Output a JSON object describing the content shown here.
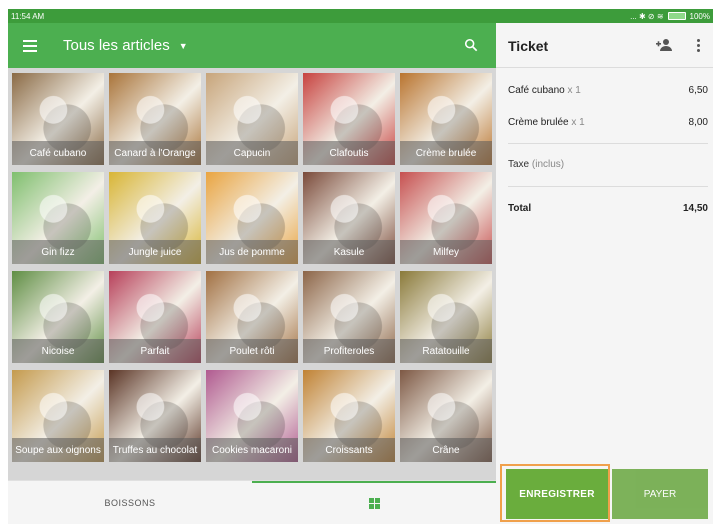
{
  "status_bar": {
    "time": "11:54 AM",
    "icons_text": "... ✱ ⊘ ≋",
    "battery": "100%"
  },
  "toolbar": {
    "title": "Tous les articles",
    "menu_icon": "menu-icon",
    "search_icon": "search-icon"
  },
  "ticket": {
    "title": "Ticket",
    "lines": [
      {
        "name": "Café cubano",
        "qty": "x 1",
        "price": "6,50"
      },
      {
        "name": "Crème brulée",
        "qty": "x 1",
        "price": "8,00"
      }
    ],
    "tax_label": "Taxe",
    "tax_note": "(inclus)",
    "total_label": "Total",
    "total_value": "14,50"
  },
  "items": [
    {
      "label": "Café cubano",
      "color": "#8a6a45"
    },
    {
      "label": "Canard à l'Orange",
      "color": "#a9743a"
    },
    {
      "label": "Capucin",
      "color": "#c7a47a"
    },
    {
      "label": "Clafoutis",
      "color": "#c7423f"
    },
    {
      "label": "Crème brulée",
      "color": "#b9742f"
    },
    {
      "label": "Gin fizz",
      "color": "#7fbf6e"
    },
    {
      "label": "Jungle juice",
      "color": "#d8b535"
    },
    {
      "label": "Jus de pomme",
      "color": "#e9a441"
    },
    {
      "label": "Kasule",
      "color": "#7a4a3a"
    },
    {
      "label": "Milfey",
      "color": "#c65050"
    },
    {
      "label": "Nicoise",
      "color": "#5f8e44"
    },
    {
      "label": "Parfait",
      "color": "#b7405a"
    },
    {
      "label": "Poulet rôti",
      "color": "#a17042"
    },
    {
      "label": "Profiteroles",
      "color": "#8c6548"
    },
    {
      "label": "Ratatouille",
      "color": "#8a7a3a"
    },
    {
      "label": "Soupe aux oignons",
      "color": "#c49a4d"
    },
    {
      "label": "Truffes au chocolat",
      "color": "#5a3425"
    },
    {
      "label": "Cookies macaroni",
      "color": "#b05a90"
    },
    {
      "label": "Croissants",
      "color": "#c08234"
    },
    {
      "label": "Crâne",
      "color": "#7d5844"
    }
  ],
  "tabs": {
    "drinks": "BOISSONS"
  },
  "actions": {
    "save": "ENREGISTRER",
    "pay": "PAYER"
  },
  "colors": {
    "accent": "#4caf50",
    "status_bar": "#3d9c3b"
  }
}
